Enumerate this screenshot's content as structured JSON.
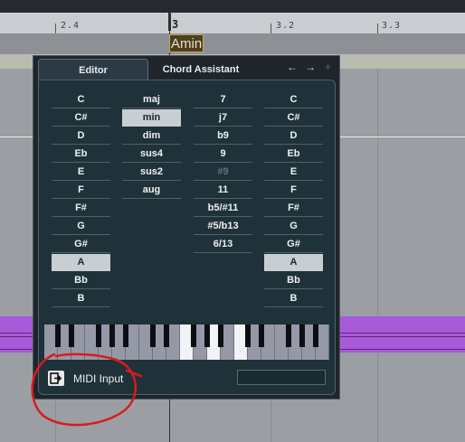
{
  "ruler": {
    "marks": [
      "2.4",
      "3",
      "3.2",
      "3.3"
    ]
  },
  "chord_track": {
    "current_chord": "Amin"
  },
  "panel": {
    "tabs": [
      {
        "label": "Editor"
      },
      {
        "label": "Chord Assistant"
      }
    ],
    "nav": {
      "back_icon": "←",
      "forward_icon": "→",
      "add_icon": "+"
    },
    "root_column": [
      "C",
      "C#",
      "D",
      "Eb",
      "E",
      "F",
      "F#",
      "G",
      "G#",
      "A",
      "Bb",
      "B"
    ],
    "root_selected": "A",
    "type_column": [
      "maj",
      "min",
      "dim",
      "sus4",
      "sus2",
      "aug"
    ],
    "type_selected": "min",
    "tension_column": [
      "7",
      "j7",
      "b9",
      "9",
      "#9",
      "11",
      "b5/#11",
      "#5/b13",
      "6/13"
    ],
    "tension_disabled": "#9",
    "bass_column": [
      "C",
      "C#",
      "D",
      "Eb",
      "E",
      "F",
      "F#",
      "G",
      "G#",
      "A",
      "Bb",
      "B"
    ],
    "bass_selected": "A",
    "midi_input_label": "MIDI Input"
  },
  "colors": {
    "accent_selected": "#c9ced3",
    "panel_bg": "#1f3139",
    "event_purple": "#a85ad8",
    "annotation_red": "#d91b1b"
  }
}
